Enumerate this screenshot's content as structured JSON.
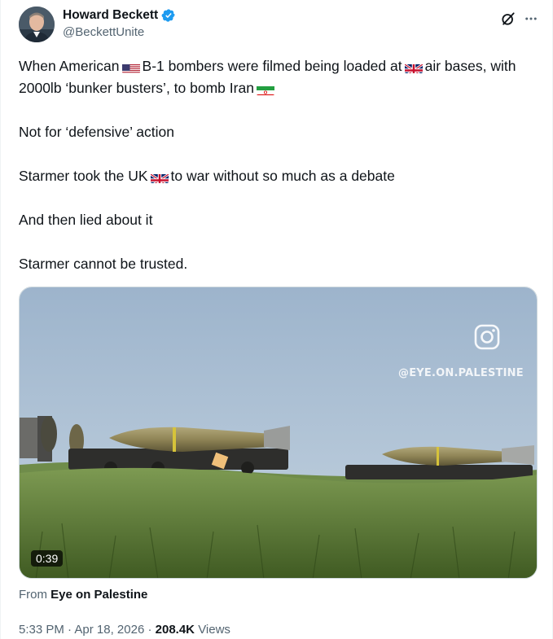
{
  "author": {
    "display_name": "Howard Beckett",
    "handle": "@BeckettUnite",
    "avatar_icon": "avatar-photo",
    "verified_color": "#1d9bf0"
  },
  "tweet": {
    "line1_a": "When American",
    "line1_b": "B-1 bombers were filmed being loaded at",
    "line1_c": "air bases, with 2000lb ‘bunker busters’, to bomb Iran",
    "line2": "Not for ‘defensive’ action",
    "line3_a": "Starmer took the UK",
    "line3_b": "to war without so much as a debate",
    "line4": "And then lied about it",
    "line5": "Starmer cannot be trusted."
  },
  "media": {
    "watermark": "@EYE.ON.PALESTINE",
    "duration": "0:39",
    "watermark_icon": "instagram-icon"
  },
  "source": {
    "prefix": "From",
    "name": "Eye on Palestine"
  },
  "meta": {
    "time": "5:33 PM",
    "date": "Apr 18, 2026",
    "views_count": "208.4K",
    "views_label": "Views",
    "separator": "·"
  },
  "colors": {
    "text": "#0f1419",
    "secondary": "#536471",
    "accent": "#1d9bf0"
  }
}
